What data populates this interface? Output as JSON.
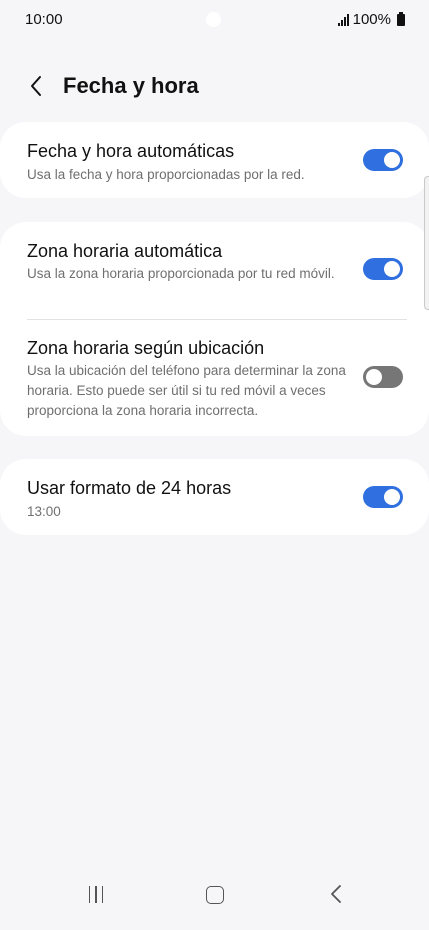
{
  "status_bar": {
    "time": "10:00",
    "battery": "100%",
    "icons": [
      "signal-icon",
      "battery-icon"
    ]
  },
  "header": {
    "title": "Fecha y hora",
    "back_icon": "chevron-left-icon"
  },
  "settings": [
    {
      "title": "Fecha y hora automáticas",
      "subtitle": "Usa la fecha y hora proporcionadas por la red.",
      "enabled": true
    },
    {
      "title": "Zona horaria automática",
      "subtitle": "Usa la zona horaria proporcionada por tu red móvil.",
      "enabled": true
    },
    {
      "title": "Zona horaria según ubicación",
      "subtitle": "Usa la ubicación del teléfono para determinar la zona horaria. Esto puede ser útil si tu red móvil a veces proporciona la zona horaria incorrecta.",
      "enabled": false
    },
    {
      "title": "Usar formato de 24 horas",
      "subtitle": "13:00",
      "enabled": true
    }
  ],
  "colors": {
    "toggle_on": "#2f6fdf",
    "toggle_off": "#767676",
    "background": "#f6f6f8",
    "card": "#ffffff"
  },
  "nav_bar": {
    "icons": [
      "recents-icon",
      "home-icon",
      "back-icon"
    ]
  }
}
